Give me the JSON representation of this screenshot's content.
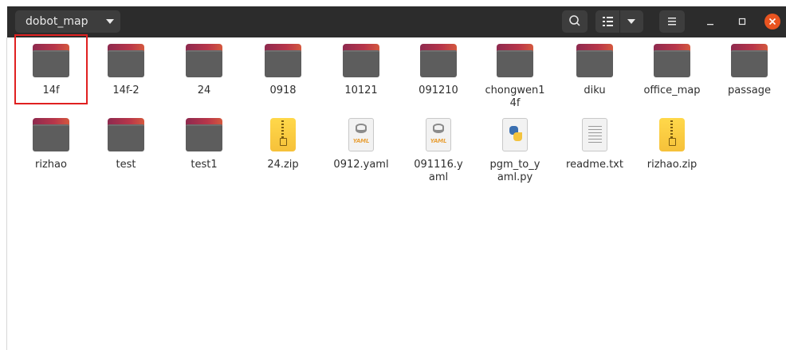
{
  "header": {
    "path_label": "dobot_map"
  },
  "colors": {
    "header_bg": "#2c2c2c",
    "close_button": "#e95420",
    "highlight": "#e02020"
  },
  "row1": [
    {
      "label": "14f",
      "icon": "folder-icon"
    },
    {
      "label": "14f-2",
      "icon": "folder-icon"
    },
    {
      "label": "24",
      "icon": "folder-icon"
    },
    {
      "label": "0918",
      "icon": "folder-icon"
    },
    {
      "label": "10121",
      "icon": "folder-icon"
    },
    {
      "label": "091210",
      "icon": "folder-icon"
    },
    {
      "label": "chongwen14f",
      "icon": "folder-icon"
    },
    {
      "label": "diku",
      "icon": "folder-icon"
    },
    {
      "label": "office_map",
      "icon": "folder-icon"
    },
    {
      "label": "passage",
      "icon": "folder-icon"
    }
  ],
  "row2": [
    {
      "label": "rizhao",
      "icon": "folder-icon"
    },
    {
      "label": "test",
      "icon": "folder-icon"
    },
    {
      "label": "test1",
      "icon": "folder-icon"
    },
    {
      "label": "24.zip",
      "icon": "zip-file-icon"
    },
    {
      "label": "0912.yaml",
      "icon": "yaml-file-icon",
      "tag": "YAML"
    },
    {
      "label": "091116.yaml",
      "icon": "yaml-file-icon",
      "tag": "YAML"
    },
    {
      "label": "pgm_to_yaml.py",
      "icon": "python-file-icon"
    },
    {
      "label": "readme.txt",
      "icon": "text-file-icon"
    },
    {
      "label": "rizhao.zip",
      "icon": "zip-file-icon"
    }
  ]
}
